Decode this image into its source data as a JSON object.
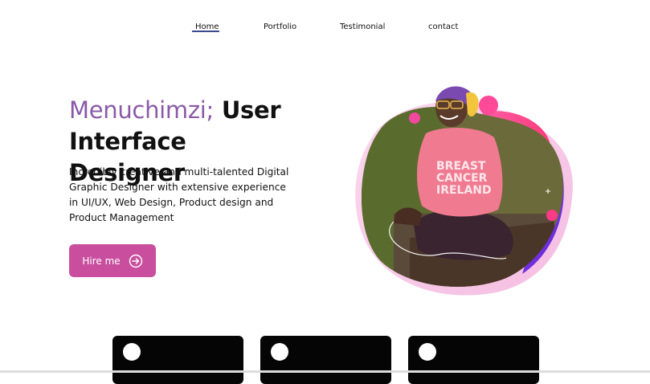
{
  "nav": {
    "items": [
      {
        "label": "Home"
      },
      {
        "label": "Portfolio"
      },
      {
        "label": "Testimonial"
      },
      {
        "label": "contact"
      }
    ]
  },
  "hero": {
    "name": "Menuchimzi;",
    "role_line1": "User",
    "role_line2": "Interface Designer",
    "description": "Incredibly creative and multi-talented Digital Graphic Designer with extensive experience in UI/UX, Web Design, Product design and Product Management",
    "cta_label": "Hire me"
  },
  "colors": {
    "accent_purple": "#8a5aa8",
    "button_pink": "#c94f9e",
    "nav_underline": "#3a4a8c",
    "card_bg": "#050505"
  },
  "icons": {
    "cta": "arrow-right-circle-icon"
  },
  "cards": [
    {
      "icon": "white-circle"
    },
    {
      "icon": "white-circle"
    },
    {
      "icon": "white-circle"
    }
  ]
}
